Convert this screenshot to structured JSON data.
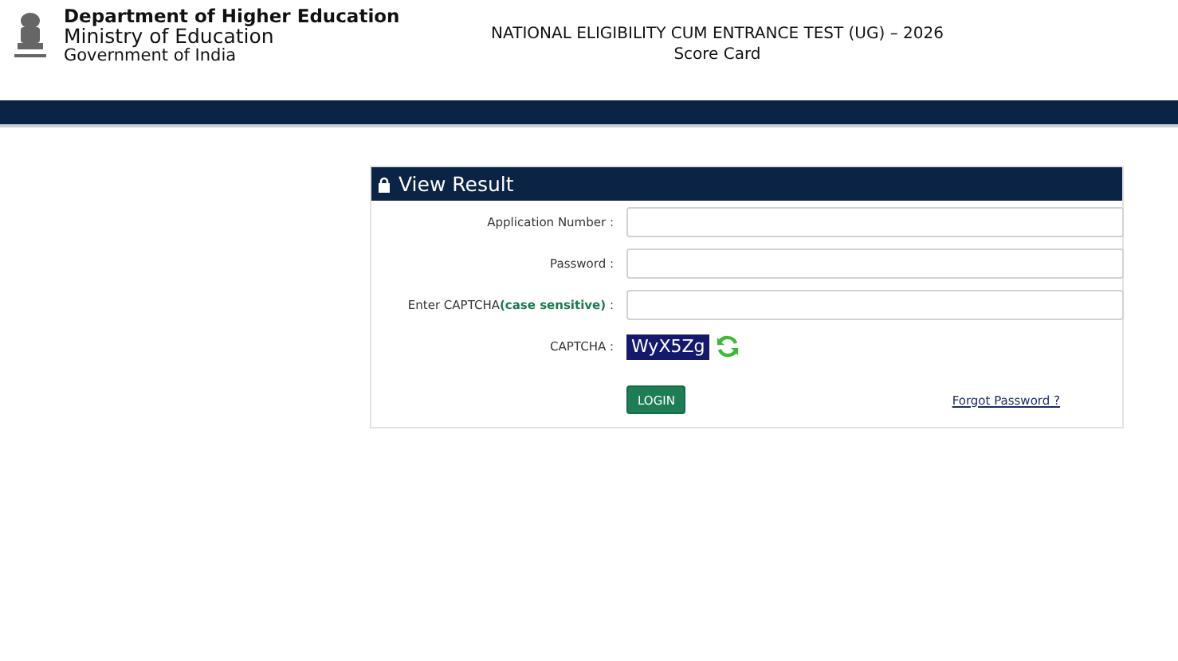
{
  "header": {
    "department": "Department of Higher Education",
    "ministry": "Ministry of Education",
    "government": "Government of India",
    "title": "NATIONAL ELIGIBILITY CUM ENTRANCE TEST (UG) – 2026",
    "subtitle": "Score Card"
  },
  "panel": {
    "title": "View Result",
    "fields": [
      {
        "kind": "text",
        "label": "Application Number :"
      },
      {
        "kind": "password",
        "label": "Password :"
      },
      {
        "kind": "text",
        "label": "Enter CAPTCHA**(case sensitive)** :"
      },
      {
        "kind": "captcha",
        "label": "CAPTCHA :",
        "code": "WyX5Zg"
      }
    ],
    "login": "LOGIN",
    "forgot": "Forgot Password ?"
  }
}
